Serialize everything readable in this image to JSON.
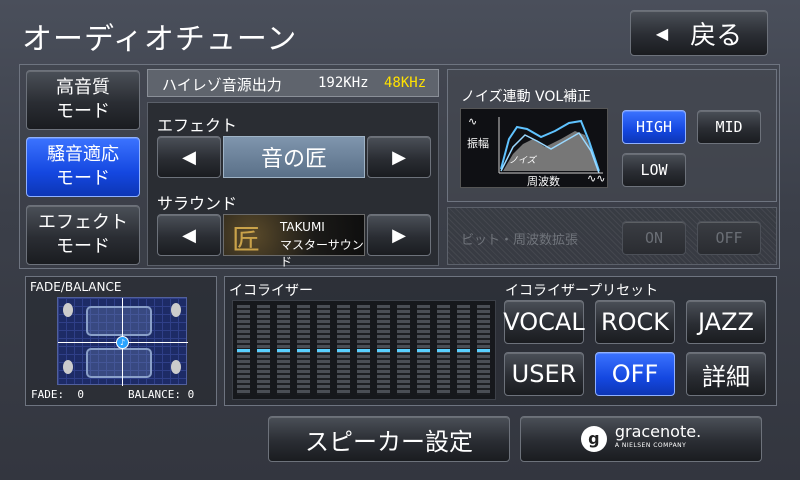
{
  "header": {
    "title": "オーディオチューン",
    "back_label": "戻る"
  },
  "modes": [
    {
      "label": "高音質\nモード",
      "active": false
    },
    {
      "label": "騒音適応\nモード",
      "active": true
    },
    {
      "label": "エフェクト\nモード",
      "active": false
    }
  ],
  "hires": {
    "label": "ハイレゾ音源出力",
    "rate1": "192KHz",
    "rate2": "48KHz",
    "rate2_color": "#ffe100"
  },
  "effect": {
    "label": "エフェクト",
    "value": "音の匠"
  },
  "surround": {
    "label": "サラウンド",
    "logo_line1": "TAKUMI",
    "logo_line2": "マスターサウンド"
  },
  "noise": {
    "title": "ノイズ連動 VOL補正",
    "graph_y_label": "振幅",
    "graph_noise_label": "ノイズ",
    "graph_x_label": "周波数",
    "options": [
      {
        "label": "HIGH",
        "selected": true
      },
      {
        "label": "MID",
        "selected": false
      },
      {
        "label": "LOW",
        "selected": false
      }
    ]
  },
  "bit": {
    "label": "ビット・周波数拡張",
    "on_label": "ON",
    "off_label": "OFF"
  },
  "fade": {
    "title": "FADE/BALANCE",
    "fade_text": "FADE:  0",
    "balance_text": "BALANCE: 0",
    "fade_value": 0,
    "balance_value": 0
  },
  "equalizer": {
    "title": "イコライザー",
    "bands": [
      0,
      0,
      0,
      0,
      0,
      0,
      0,
      0,
      0,
      0,
      0,
      0,
      0
    ]
  },
  "preset": {
    "title": "イコライザープリセット",
    "buttons": [
      {
        "label": "VOCAL",
        "selected": false
      },
      {
        "label": "ROCK",
        "selected": false
      },
      {
        "label": "JAZZ",
        "selected": false
      },
      {
        "label": "USER",
        "selected": false
      },
      {
        "label": "OFF",
        "selected": true
      },
      {
        "label": "詳細",
        "selected": false
      }
    ]
  },
  "footer": {
    "speaker_label": "スピーカー設定",
    "gracenote_name": "gracenote.",
    "gracenote_sub": "A NIELSEN COMPANY"
  }
}
